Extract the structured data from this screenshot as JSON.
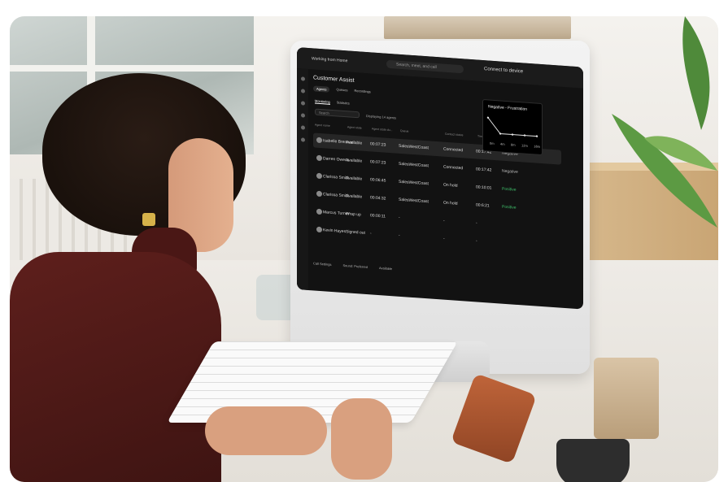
{
  "app": {
    "workspace": "Working from Home",
    "search_placeholder": "Search, meet, and call",
    "connect_label": "Connect to device",
    "page_title": "Customer Assist",
    "tabs": [
      "Agents",
      "Queues",
      "Recordings"
    ],
    "subtabs": [
      "Monitoring",
      "Statistics"
    ],
    "search_input": "Search",
    "agents_count": "Displaying 14 agents"
  },
  "table": {
    "columns": [
      "Agent name",
      "Agent state",
      "Agent state du...",
      "Queue",
      "Contact status",
      "Time in..."
    ],
    "rows": [
      {
        "name": "Isabelle Brennan",
        "state": "Available",
        "duration": "00:07:23",
        "queue": "SalesWestCoast",
        "status": "Connected",
        "time": "00:17:42",
        "sentiment": "Negative",
        "tone": "neg"
      },
      {
        "name": "Darren Owens",
        "state": "Available",
        "duration": "00:07:23",
        "queue": "SalesWestCoast",
        "status": "Connected",
        "time": "00:17:42",
        "sentiment": "Negative",
        "tone": "neg"
      },
      {
        "name": "Clarissa Smith",
        "state": "Available",
        "duration": "00:06:45",
        "queue": "SalesWestCoast",
        "status": "On hold",
        "time": "00:10:01",
        "sentiment": "Positive",
        "tone": "pos"
      },
      {
        "name": "Clarissa Smith",
        "state": "Available",
        "duration": "00:04:32",
        "queue": "SalesWestCoast",
        "status": "On hold",
        "time": "00:6:21",
        "sentiment": "Positive",
        "tone": "pos"
      },
      {
        "name": "Marcus Turner",
        "state": "Wrap up",
        "duration": "00:00:11",
        "queue": "-",
        "status": "-",
        "time": "-",
        "sentiment": "",
        "tone": ""
      },
      {
        "name": "Kevin Hayes",
        "state": "Signed out",
        "duration": "-",
        "queue": "-",
        "status": "-",
        "time": "-",
        "sentiment": "",
        "tone": ""
      }
    ]
  },
  "tooltip": {
    "title": "Negative - Frustration",
    "ticks": [
      "0m",
      "4m",
      "8m",
      "12m",
      "16m"
    ]
  },
  "footer": {
    "call_settings": "Call Settings",
    "sound": "Sound: Preferred",
    "availability": "Available"
  },
  "chart_data": {
    "type": "line",
    "title": "Negative - Frustration",
    "x": [
      "0m",
      "4m",
      "8m",
      "12m",
      "16m"
    ],
    "series": [
      {
        "values": [
          2,
          0.6,
          0.6,
          0.6,
          0.6
        ]
      }
    ],
    "ylim": [
      0,
      2.4
    ]
  },
  "colors": {
    "screen_bg": "#121212",
    "positive": "#3fbf6a",
    "sweater": "#5e1f1c"
  }
}
